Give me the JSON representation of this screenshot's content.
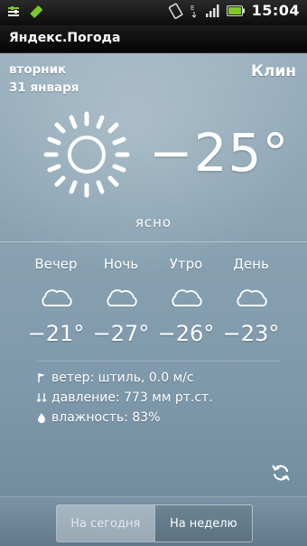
{
  "status_bar": {
    "time": "15:04"
  },
  "app": {
    "title": "Яндекс.Погода"
  },
  "current": {
    "weekday": "вторник",
    "date": "31 января",
    "city": "Клин",
    "temperature": "−25°",
    "condition": "ясно",
    "condition_icon": "sun-icon"
  },
  "periods": [
    {
      "label": "Вечер",
      "temp": "−21°",
      "icon": "cloud-icon"
    },
    {
      "label": "Ночь",
      "temp": "−27°",
      "icon": "cloud-icon"
    },
    {
      "label": "Утро",
      "temp": "−26°",
      "icon": "cloud-icon"
    },
    {
      "label": "День",
      "temp": "−23°",
      "icon": "cloud-icon"
    }
  ],
  "details": {
    "wind": "ветер: штиль, 0.0 м/с",
    "pressure": "давление: 773 мм рт.ст.",
    "humidity": "влажность: 83%"
  },
  "tabs": {
    "today": "На сегодня",
    "week": "На неделю"
  },
  "colors": {
    "background": "#8aa3b3",
    "text": "#ffffff",
    "battery": "#7ec828"
  }
}
